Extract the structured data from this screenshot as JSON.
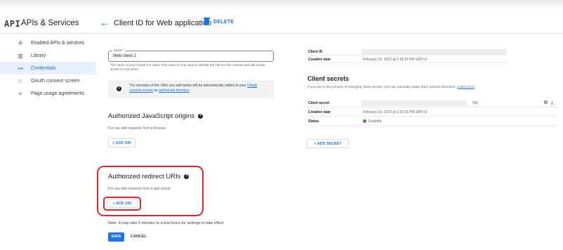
{
  "header": {
    "logo": "API",
    "service_title": "APIs & Services",
    "page_title": "Client ID for Web application",
    "delete_label": "DELETE"
  },
  "sidebar": {
    "items": [
      {
        "label": "Enabled APIs & services",
        "icon": "enabled-apis-icon",
        "glyph": "✣"
      },
      {
        "label": "Library",
        "icon": "library-icon",
        "glyph": "▥"
      },
      {
        "label": "Credentials",
        "icon": "key-icon",
        "glyph": "⊶"
      },
      {
        "label": "OAuth consent screen",
        "icon": "consent-screen-icon",
        "glyph": "⁝⁝"
      },
      {
        "label": "Page usage agreements",
        "icon": "settings-list-icon",
        "glyph": "≡"
      }
    ],
    "active_index": 2
  },
  "form": {
    "name_label": "Name *",
    "name_value": "Web client 1",
    "name_help": "The name of your OAuth 2.0 client. This name is only used to identify the client in the console and will not be shown to end users.",
    "info_text_prefix": "The domains of the URIs you add below will be automatically added to your",
    "info_link1": "OAuth consent screen",
    "info_mid": "as",
    "info_link2": "authorized domains",
    "info_suffix": ".",
    "js_origins_title": "Authorized JavaScript origins",
    "js_origins_sub": "For use with requests from a browser",
    "add_uri_label": "+ ADD URI",
    "redirect_title": "Authorized redirect URIs",
    "redirect_sub": "For use with requests from a web server",
    "note": "Note: It may take 5 minutes to a few hours for settings to take effect",
    "save_label": "SAVE",
    "cancel_label": "CANCEL"
  },
  "details": {
    "client_id_label": "Client ID",
    "creation_date_label": "Creation date",
    "creation_date_value": "February 10, 2023 at 2:19:32 PM GMT+3"
  },
  "secrets": {
    "title": "Client secrets",
    "subtitle": "If you are in the process of changing client secrets, you can manually rotate them without downtime.",
    "learn_more": "Learn more",
    "secret_label": "Client secret",
    "secret_tail": "7Ulj",
    "creation_date_label": "Creation date",
    "creation_date_value": "February 10, 2023 at 2:19:32 PM GMT+3",
    "status_label": "Status",
    "status_value": "Enabled",
    "add_secret_label": "+ ADD SECRET"
  },
  "colors": {
    "accent": "#1a73e8",
    "highlight_box": "#e3262b",
    "enabled": "#1e8e3e"
  }
}
